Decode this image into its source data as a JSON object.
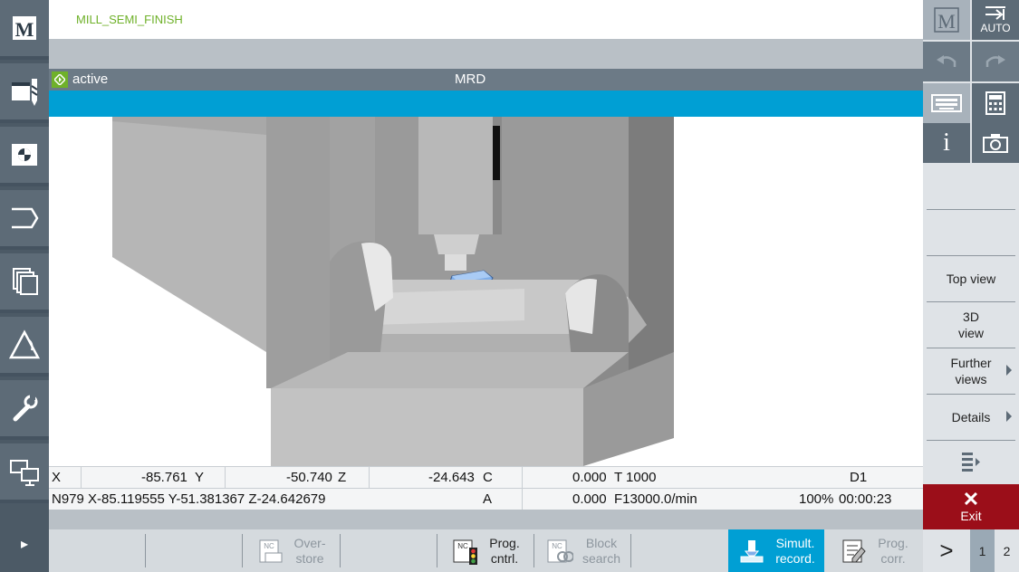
{
  "header": {
    "program_name": "MILL_SEMI_FINISH",
    "status": "active",
    "channel": "MRD"
  },
  "positions": {
    "row1": {
      "x_label": "X",
      "x_value": "-85.761",
      "y_label": "Y",
      "y_value": "-50.740",
      "z_label": "Z",
      "z_value": "-24.643",
      "c_label": "C",
      "c_value": "0.000",
      "tool": "T 1000",
      "d": "D1"
    },
    "row2": {
      "block": "N979 X-85.119555 Y-51.381367 Z-24.642679",
      "a_label": "A",
      "a_value": "0.000",
      "feed": "F13000.0/min",
      "override": "100%",
      "time": "00:00:23"
    }
  },
  "bottom_softkeys": {
    "overstore": "Over-\nstore",
    "prog_cntrl": "Prog.\ncntrl.",
    "block_search": "Block\nsearch",
    "simult_record": "Simult.\nrecord.",
    "prog_corr": "Prog.\ncorr.",
    "nc_label": "NC"
  },
  "right_panel": {
    "auto_label": "AUTO",
    "top_view": "Top view",
    "view_3d": "3D\nview",
    "further_views": "Further\nviews",
    "details": "Details",
    "exit": "Exit",
    "page_next": ">",
    "page_1": "1",
    "page_2": "2",
    "info_icon": "i"
  },
  "colors": {
    "accent_blue": "#009fd4",
    "active_green": "#6fb12a",
    "exit_red": "#9b0e19",
    "dark_slate": "#5d6b77"
  },
  "icons": [
    "machine-icon",
    "program-icon",
    "offset-icon",
    "program-manager-icon",
    "diagnosis-icon",
    "alarm-icon",
    "setup-icon",
    "network-icon",
    "auto-mode-icon",
    "undo-icon",
    "redo-icon",
    "keyboard-icon",
    "calculator-icon",
    "info-icon",
    "camera-icon"
  ]
}
